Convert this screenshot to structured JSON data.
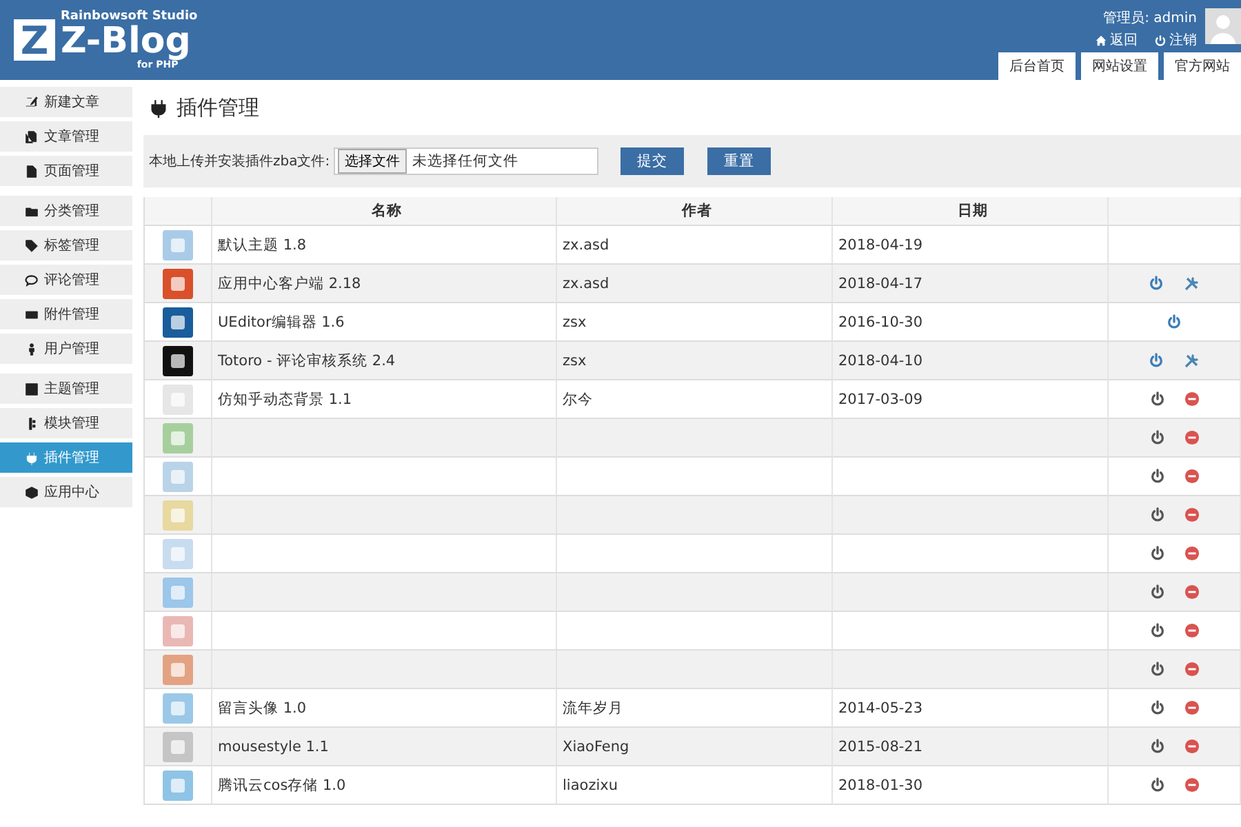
{
  "header": {
    "studio": "Rainbowsoft Studio",
    "logo_letter": "Z",
    "product": "Z-Blog",
    "product_sub": "for PHP",
    "user_label": "管理员: admin",
    "links": [
      "返回",
      "注销"
    ],
    "tabs": [
      "后台首页",
      "网站设置",
      "官方网站"
    ]
  },
  "sidebar": {
    "groups": [
      [
        {
          "label": "新建文章",
          "selected": false
        },
        {
          "label": "文章管理",
          "selected": false
        },
        {
          "label": "页面管理",
          "selected": false
        }
      ],
      [
        {
          "label": "分类管理",
          "selected": false
        },
        {
          "label": "标签管理",
          "selected": false
        },
        {
          "label": "评论管理",
          "selected": false
        },
        {
          "label": "附件管理",
          "selected": false
        },
        {
          "label": "用户管理",
          "selected": false
        }
      ],
      [
        {
          "label": "主题管理",
          "selected": false
        },
        {
          "label": "模块管理",
          "selected": false
        },
        {
          "label": "插件管理",
          "selected": true
        },
        {
          "label": "应用中心",
          "selected": false
        }
      ]
    ]
  },
  "page_title": "插件管理",
  "upload": {
    "label": "本地上传并安装插件zba文件:",
    "choose_button": "选择文件",
    "file_status": "未选择任何文件",
    "buttons": [
      "提交",
      "重置"
    ]
  },
  "table": {
    "columns": [
      "名称",
      "作者",
      "日期"
    ],
    "rows": [
      {
        "color": "#a9cbe8",
        "name": "默认主题 1.8",
        "author": "zx.asd",
        "date": "2018-04-19"
      },
      {
        "color": "#d9502b",
        "name": "应用中心客户端 2.18",
        "author": "zx.asd",
        "date": "2018-04-17",
        "enabled": true,
        "settings": true
      },
      {
        "color": "#1a5d9c",
        "name": "UEditor编辑器 1.6",
        "author": "zsx",
        "date": "2016-10-30",
        "enabled": true
      },
      {
        "color": "#111111",
        "name": "Totoro - 评论审核系统 2.4",
        "author": "zsx",
        "date": "2018-04-10",
        "enabled": true,
        "settings": true
      },
      {
        "color": "#e6e6e6",
        "name": "仿知乎动态背景 1.1",
        "author": "尔今",
        "date": "2017-03-09",
        "enabled": false,
        "delete": true
      },
      {
        "color": "#a7cf9e",
        "enabled": false,
        "delete": true
      },
      {
        "color": "#b9d3e8",
        "enabled": false,
        "delete": true
      },
      {
        "color": "#e8d9a0",
        "enabled": false,
        "delete": true
      },
      {
        "color": "#c8dcef",
        "enabled": false,
        "delete": true
      },
      {
        "color": "#9cc6ea",
        "enabled": false,
        "delete": true
      },
      {
        "color": "#e9b8b5",
        "enabled": false,
        "delete": true
      },
      {
        "color": "#e3a382",
        "enabled": false,
        "delete": true
      },
      {
        "color": "#9cc8e8",
        "name": "留言头像 1.0",
        "author": "流年岁月",
        "date": "2014-05-23",
        "enabled": false,
        "delete": true
      },
      {
        "color": "#c5c5c5",
        "name": "mousestyle 1.1",
        "author": "XiaoFeng",
        "date": "2015-08-21",
        "enabled": false,
        "delete": true
      },
      {
        "color": "#8fc4e6",
        "name": "腾讯云cos存储 1.0",
        "author": "liaozixu",
        "date": "2018-01-30",
        "enabled": false,
        "delete": true
      }
    ]
  }
}
